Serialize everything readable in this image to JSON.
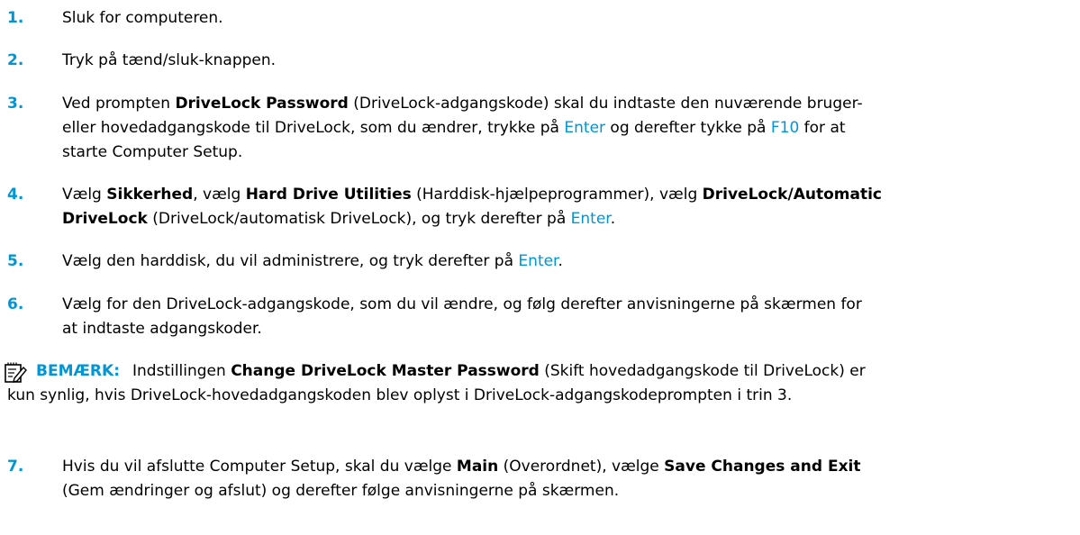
{
  "colors": {
    "accent": "#0096d6",
    "text": "#000000",
    "background": "#ffffff"
  },
  "steps": [
    {
      "num": "1.",
      "lines": [
        [
          "Sluk for computeren."
        ]
      ]
    },
    {
      "num": "2.",
      "lines": [
        [
          "Tryk på tænd/sluk-knappen."
        ]
      ]
    },
    {
      "num": "3.",
      "lines": [
        [
          "Ved prompten ",
          "DriveLock Password",
          " (DriveLock-adgangskode) skal du indtaste den nuværende bruger-"
        ],
        [
          "eller hovedadgangskode til DriveLock, som du ændrer, trykke på ",
          "Enter",
          " og derefter tykke på ",
          "F10",
          " for at"
        ],
        [
          "starte Computer Setup."
        ]
      ]
    },
    {
      "num": "4.",
      "lines": [
        [
          "Vælg ",
          "Sikkerhed",
          ", vælg ",
          "Hard Drive Utilities",
          " (Harddisk-hjælpeprogrammer), vælg ",
          "DriveLock/Automatic"
        ],
        [
          "DriveLock",
          " (DriveLock/automatisk DriveLock), og tryk derefter på ",
          "Enter",
          "."
        ]
      ]
    },
    {
      "num": "5.",
      "lines": [
        [
          "Vælg den harddisk, du vil administrere, og tryk derefter på ",
          "Enter",
          "."
        ]
      ]
    },
    {
      "num": "6.",
      "lines": [
        [
          "Vælg for den DriveLock-adgangskode, som du vil ændre, og følg derefter anvisningerne på skærmen for"
        ],
        [
          "at indtaste adgangskoder."
        ]
      ]
    },
    {
      "num": "7.",
      "lines": [
        [
          "Hvis du vil afslutte Computer Setup, skal du vælge ",
          "Main",
          " (Overordnet), vælge ",
          "Save Changes and Exit"
        ],
        [
          "(Gem ændringer og afslut) og derefter følge anvisningerne på skærmen."
        ]
      ]
    }
  ],
  "note": {
    "icon": "note-icon",
    "label": "BEMÆRK:",
    "line1": [
      "Indstillingen ",
      "Change DriveLock Master Password",
      " (Skift hovedadgangskode til DriveLock) er"
    ],
    "line2": "kun synlig, hvis DriveLock-hovedadgangskoden blev oplyst i DriveLock-adgangskodeprompten i trin 3."
  }
}
